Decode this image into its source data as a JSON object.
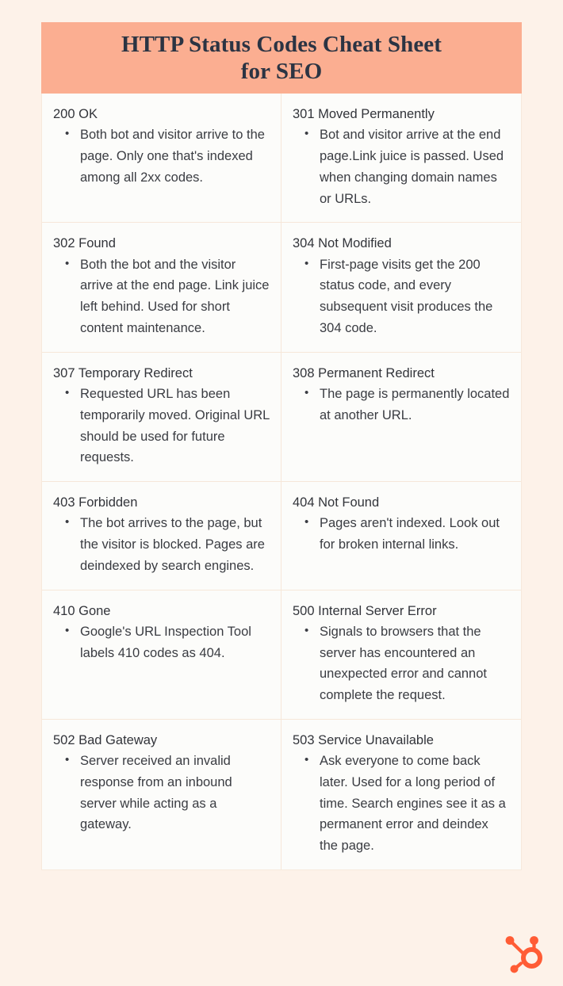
{
  "page": {
    "background_color": "#FDF2E9",
    "accent_color": "#FBAE91",
    "title_color": "#2B3443",
    "brand_color": "#FF5C35"
  },
  "header": {
    "title": "HTTP Status Codes Cheat Sheet for SEO",
    "title_line1": "HTTP Status Codes Cheat Sheet",
    "title_line2": "for SEO"
  },
  "table": {
    "rows": [
      {
        "cells": [
          {
            "code": "200 OK",
            "bullets": [
              "Both bot and visitor arrive to the page. Only one that's indexed among all 2xx codes."
            ]
          },
          {
            "code": "301 Moved Permanently",
            "bullets": [
              "Bot and visitor arrive at the end page.Link juice is passed. Used when changing domain names or URLs."
            ]
          }
        ]
      },
      {
        "cells": [
          {
            "code": "302 Found",
            "bullets": [
              "Both the bot and the visitor arrive at the end page. Link juice left behind. Used for short content maintenance."
            ]
          },
          {
            "code": "304 Not Modified",
            "bullets": [
              "First-page visits get the 200 status code, and every subsequent visit produces the 304 code."
            ]
          }
        ]
      },
      {
        "cells": [
          {
            "code": "307 Temporary Redirect",
            "bullets": [
              "Requested URL has been temporarily moved. Original URL should be used for future requests."
            ]
          },
          {
            "code": "308 Permanent Redirect",
            "bullets": [
              "The page is permanently located at another URL."
            ]
          }
        ]
      },
      {
        "cells": [
          {
            "code": "403 Forbidden",
            "bullets": [
              "The bot arrives to the page, but the visitor is blocked. Pages are deindexed by search engines."
            ]
          },
          {
            "code": "404 Not Found",
            "bullets": [
              "Pages aren't indexed. Look out for broken internal links."
            ]
          }
        ]
      },
      {
        "cells": [
          {
            "code": "410 Gone",
            "bullets": [
              "Google's URL Inspection Tool labels 410 codes as 404."
            ]
          },
          {
            "code": "500 Internal Server Error",
            "bullets": [
              "Signals to browsers that the server has encountered an unexpected error and cannot complete the request."
            ]
          }
        ]
      },
      {
        "cells": [
          {
            "code": "502 Bad Gateway",
            "bullets": [
              "Server received an invalid response from an inbound server while acting as a gateway."
            ]
          },
          {
            "code": "503 Service Unavailable",
            "bullets": [
              "Ask everyone to come back later. Used for a long period of time. Search engines see it as a permanent error and deindex the page."
            ]
          }
        ]
      }
    ]
  },
  "footer": {
    "logo_name": "hubspot-sprocket-logo",
    "logo_color": "#FF5C35"
  }
}
